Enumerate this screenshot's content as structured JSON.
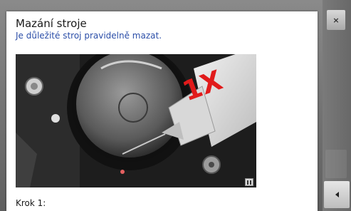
{
  "dialog": {
    "title": "Mazání stroje",
    "subtitle": "Je důležité stroj pravidelně mazat.",
    "step_label": "Krok 1:",
    "image_overlay_text": "1X"
  },
  "controls": {
    "close_icon": "close-icon",
    "pause_icon": "pause-icon",
    "prev_icon": "arrow-left-icon"
  },
  "colors": {
    "subtitle": "#2b4ea8",
    "overlay_text": "#e11b1b"
  }
}
